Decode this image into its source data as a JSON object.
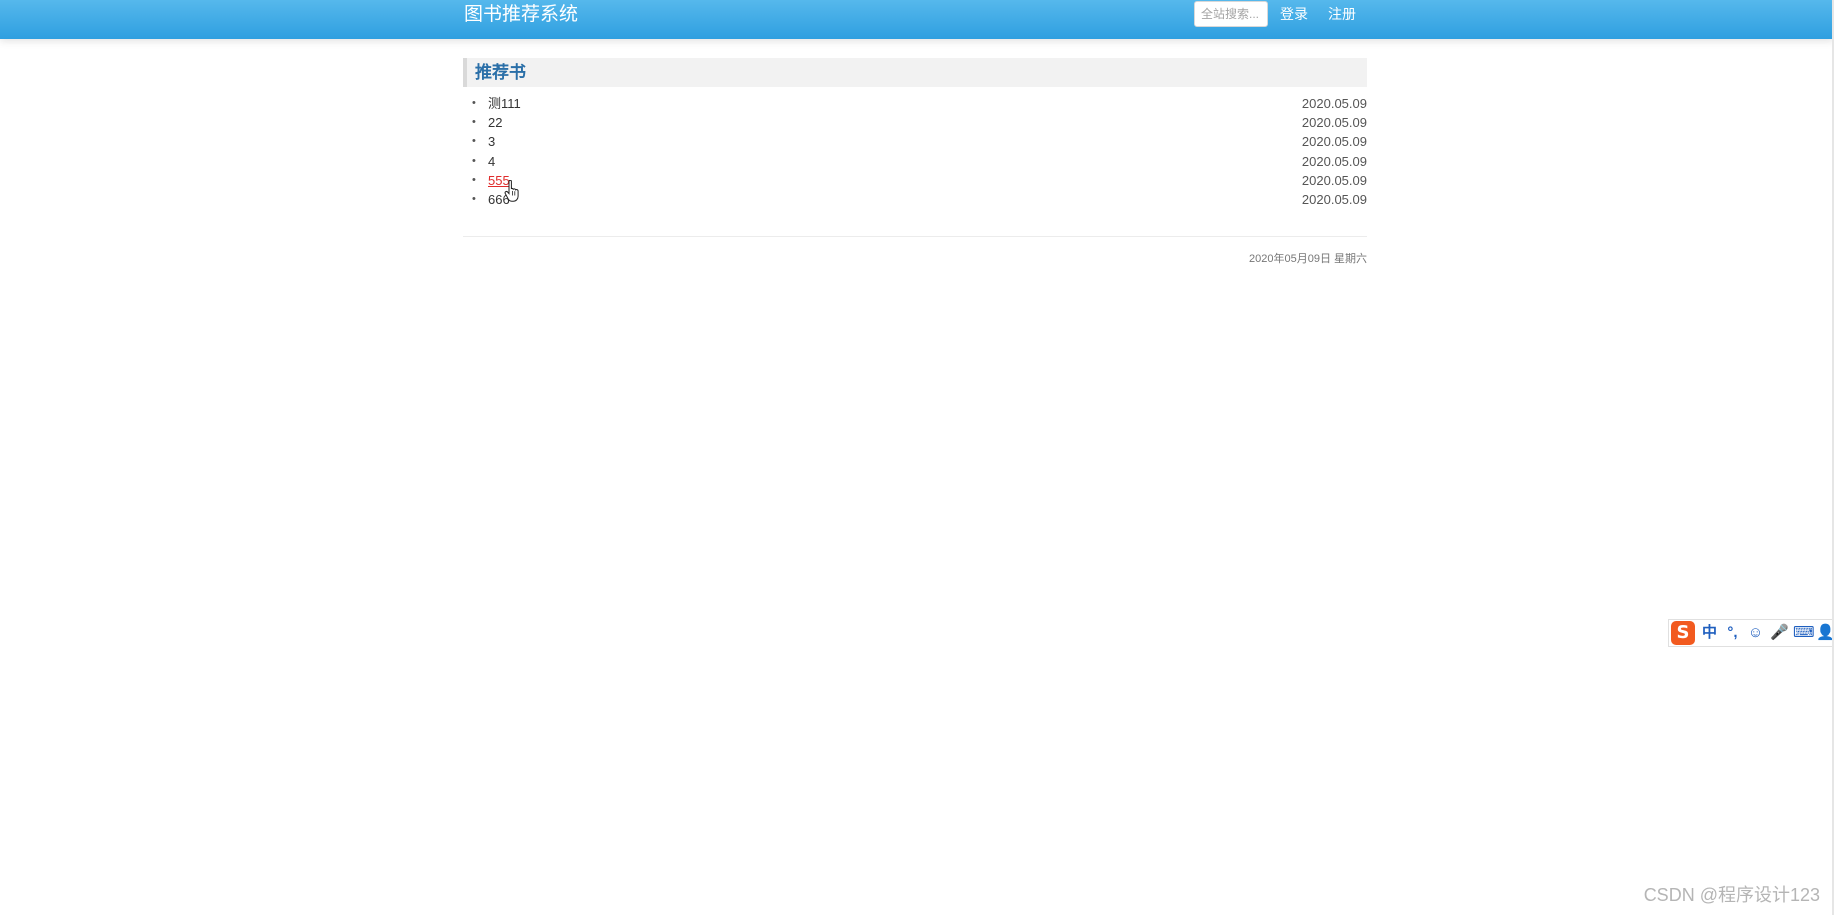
{
  "header": {
    "site_title": "图书推荐系统",
    "search_placeholder": "全站搜索...",
    "login_label": "登录",
    "register_label": "注册"
  },
  "section": {
    "title": "推荐书",
    "bullet": "•",
    "books": [
      {
        "title": "测111",
        "date": "2020.05.09"
      },
      {
        "title": "22",
        "date": "2020.05.09"
      },
      {
        "title": "3",
        "date": "2020.05.09"
      },
      {
        "title": "4",
        "date": "2020.05.09"
      },
      {
        "title": "555",
        "date": "2020.05.09",
        "hovered": true
      },
      {
        "title": "666",
        "date": "2020.05.09"
      }
    ]
  },
  "footer": {
    "date_text": "2020年05月09日 星期六"
  },
  "ime_toolbar": {
    "logo": "S",
    "items": [
      {
        "icon": "chinese-mode-icon",
        "glyph": "中"
      },
      {
        "icon": "punctuation-icon",
        "glyph": "°,"
      },
      {
        "icon": "emoji-icon",
        "glyph": "☺"
      },
      {
        "icon": "microphone-icon",
        "glyph": "🎤"
      },
      {
        "icon": "keyboard-icon",
        "glyph": "⌨"
      },
      {
        "icon": "user-icon",
        "glyph": "👤"
      }
    ]
  },
  "watermark": "CSDN @程序设计123",
  "colors": {
    "header_bg": "#3aa9e6",
    "section_title": "#2a6fa8",
    "hover_link": "#e02b2b",
    "ime_logo": "#f25a1f"
  }
}
